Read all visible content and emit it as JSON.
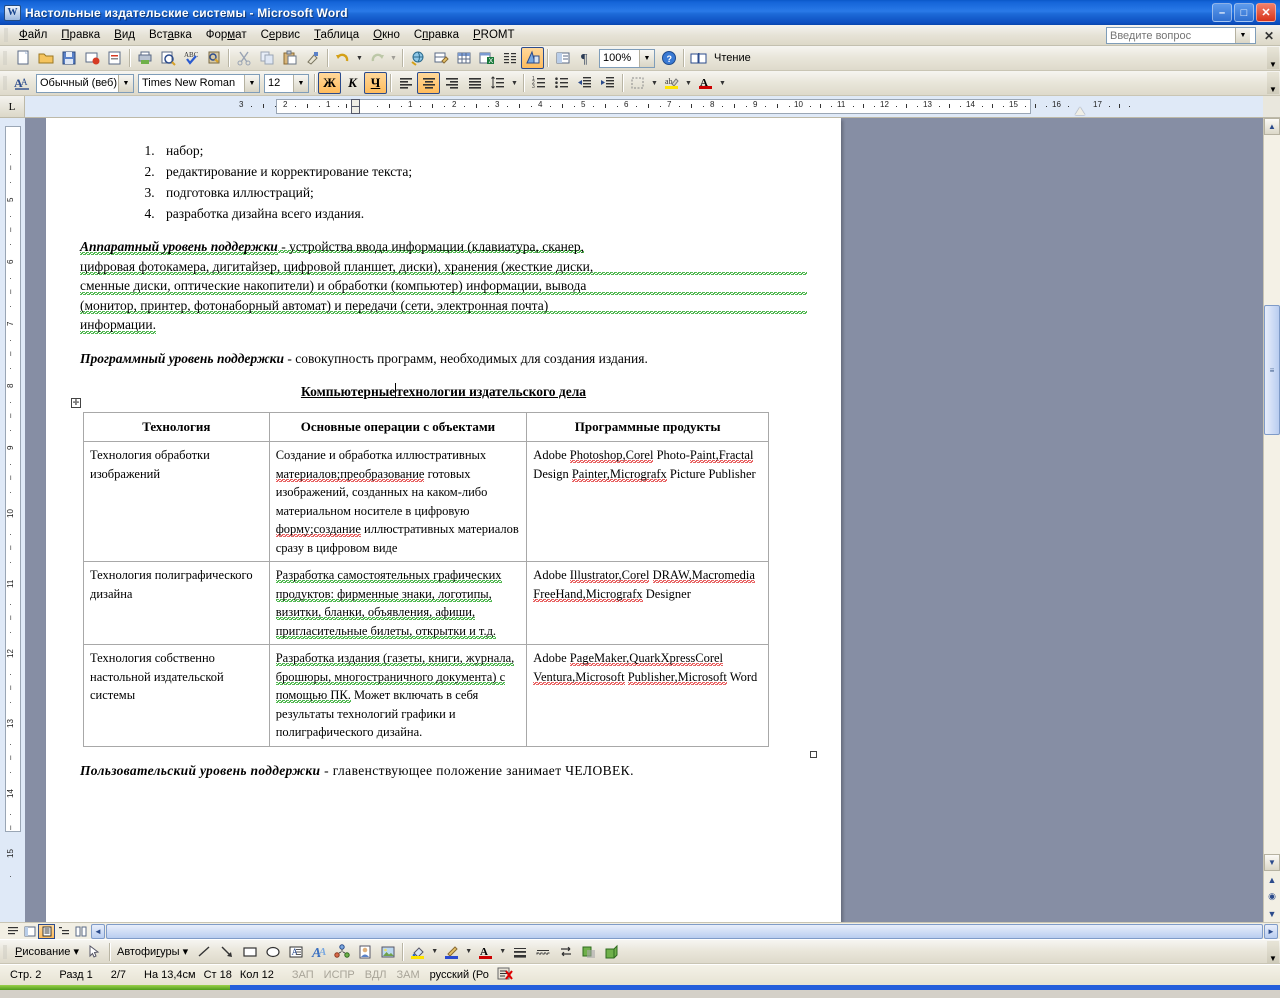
{
  "window": {
    "title": "Настольные издательские системы - Microsoft Word",
    "app_icon": "word-document-icon",
    "minimize": "–",
    "maximize": "□",
    "close": "✕"
  },
  "menu": {
    "items": [
      "Файл",
      "Правка",
      "Вид",
      "Вставка",
      "Формат",
      "Сервис",
      "Таблица",
      "Окно",
      "Справка",
      "PROMT"
    ],
    "ask_placeholder": "Введите вопрос",
    "ask_value": "",
    "close_doc": "✕"
  },
  "standard_toolbar": {
    "zoom_value": "100%",
    "reading_label": "Чтение",
    "buttons": [
      "new-document-icon",
      "open-folder-icon",
      "save-disk-icon",
      "mail-recipient-icon",
      "permission-icon",
      "print-icon",
      "print-preview-icon",
      "spelling-check-icon",
      "research-icon",
      "cut-scissors-icon",
      "copy-icon",
      "paste-clipboard-icon",
      "format-painter-icon",
      "undo-arrow-icon",
      "redo-arrow-icon",
      "insert-hyperlink-icon",
      "tables-and-borders-icon",
      "insert-table-icon",
      "insert-excel-sheet-icon",
      "columns-icon",
      "drawing-icon",
      "document-map-icon",
      "show-formatting-marks-icon",
      "microsoft-word-help-icon",
      "reading-layout-icon"
    ]
  },
  "formatting_toolbar": {
    "style_value": "Обычный (веб)",
    "font_value": "Times New Roman",
    "size_value": "12",
    "bold_label": "Ж",
    "italic_label": "К",
    "underline_label": "Ч",
    "bold_active": true,
    "italic_active": false,
    "underline_active": true,
    "align_center_active": true,
    "buttons": [
      "styles-and-formatting-icon",
      "align-left-icon",
      "align-center-icon",
      "align-right-icon",
      "justify-icon",
      "line-spacing-icon",
      "numbering-icon",
      "bullets-icon",
      "decrease-indent-icon",
      "increase-indent-icon",
      "borders-icon",
      "highlight-color-icon",
      "font-color-icon"
    ]
  },
  "ruler": {
    "corner_label": "L",
    "horizontal_ticks": [
      "3",
      "2",
      "1",
      "1",
      "2",
      "3",
      "4",
      "5",
      "6",
      "7",
      "8",
      "9",
      "10",
      "11",
      "12",
      "13",
      "14",
      "15",
      "16",
      "17"
    ],
    "vertical_ticks": [
      "5",
      "6",
      "7",
      "8",
      "9",
      "10",
      "11",
      "12",
      "13",
      "14"
    ]
  },
  "document": {
    "numbered_list": [
      "набор;",
      "редактирование и корректирование текста;",
      "подготовка иллюстраций;",
      "разработка дизайна всего издания."
    ],
    "para_hardware_term": "Аппаратный уровень поддержки",
    "para_hardware_lines": [
      " - устройства ввода информации (клавиатура, сканер,",
      "цифровая фотокамера, дигитайзер, цифровой планшет, диски), хранения (жесткие диски,",
      "сменные диски, оптические накопители) и обработки (компьютер) информации, вывода",
      "(монитор, принтер, фотонаборный автомат) и передачи (сети, электронная почта)",
      "информации."
    ],
    "para_software_term": "Программный уровень поддержки",
    "para_software_text": " - совокупность программ, необходимых для создания издания.",
    "table_title_part1": "Компьютерные",
    "table_title_part2": "технологии издательского дела",
    "table": {
      "headers": [
        "Технология",
        "Основные операции с объектами",
        "Программные продукты"
      ],
      "rows": [
        {
          "technology": "Технология обработки изображений",
          "operations_segments": [
            {
              "text": "Создание и обработка иллюстративных ",
              "mark": "none"
            },
            {
              "text": "материалов;преобразование",
              "mark": "spell"
            },
            {
              "text": " готовых изображений, созданных на каком-либо материальном носителе в цифровую ",
              "mark": "none"
            },
            {
              "text": "форму;создание",
              "mark": "spell"
            },
            {
              "text": " иллюстративных материалов сразу в цифровом виде",
              "mark": "none"
            }
          ],
          "products_segments": [
            {
              "text": "Adobe ",
              "mark": "none"
            },
            {
              "text": "Photoshop,Corel",
              "mark": "spell"
            },
            {
              "text": " Photo-",
              "mark": "none"
            },
            {
              "text": "Paint,Fractal",
              "mark": "spell"
            },
            {
              "text": " Design ",
              "mark": "none"
            },
            {
              "text": "Painter,Micrografx",
              "mark": "spell"
            },
            {
              "text": " Picture Publisher",
              "mark": "none"
            }
          ]
        },
        {
          "technology": "Технология полиграфического дизайна",
          "operations_segments": [
            {
              "text": "Разработка самостоятельных графических продуктов: фирменные знаки, логотипы, визитки, бланки, объявления, афиши, пригласительные билеты, открытки и т.д.",
              "mark": "grammar"
            }
          ],
          "products_segments": [
            {
              "text": "Adobe ",
              "mark": "none"
            },
            {
              "text": "Illustrator,Corel",
              "mark": "spell"
            },
            {
              "text": " ",
              "mark": "none"
            },
            {
              "text": "DRAW,Macromedia",
              "mark": "spell"
            },
            {
              "text": " ",
              "mark": "none"
            },
            {
              "text": "FreeHand,Micrografx",
              "mark": "spell"
            },
            {
              "text": " Designer",
              "mark": "none"
            }
          ]
        },
        {
          "technology": "Технология собственно настольной издательской системы",
          "operations_segments": [
            {
              "text": "Разработка издания (газеты, книги, журнала, брошюры, многостраничного документа) с помощью ПК.",
              "mark": "grammar"
            },
            {
              "text": " Может включать в себя результаты технологий графики и полиграфического дизайна.",
              "mark": "none"
            }
          ],
          "products_segments": [
            {
              "text": "Adobe ",
              "mark": "none"
            },
            {
              "text": "PageMaker,QuarkXpressCorel",
              "mark": "spell"
            },
            {
              "text": " ",
              "mark": "none"
            },
            {
              "text": "Ventura,Microsoft",
              "mark": "spell"
            },
            {
              "text": " ",
              "mark": "none"
            },
            {
              "text": "Publisher,Microsoft",
              "mark": "spell"
            },
            {
              "text": " Word",
              "mark": "none"
            }
          ]
        }
      ]
    },
    "para_user_term": "Пользовательский уровень поддержки",
    "para_user_text": " -   главенствующее   положение   занимает ЧЕЛОВЕК."
  },
  "drawing_toolbar": {
    "draw_label": "Рисование",
    "autoshapes_label": "Автофигуры",
    "buttons": [
      "select-objects-arrow-icon",
      "line-icon",
      "arrow-icon",
      "rectangle-icon",
      "oval-icon",
      "text-box-icon",
      "wordart-icon",
      "diagram-icon",
      "clip-art-icon",
      "insert-picture-icon",
      "fill-color-icon",
      "line-color-icon",
      "font-color-icon",
      "line-style-icon",
      "dash-style-icon",
      "arrow-style-icon",
      "shadow-style-icon",
      "3d-style-icon"
    ]
  },
  "view_buttons": [
    "normal-view-icon",
    "web-layout-view-icon",
    "print-layout-view-icon",
    "outline-view-icon",
    "reading-layout-view-icon"
  ],
  "status_bar": {
    "page": "Стр. 2",
    "section": "Разд 1",
    "page_of": "2/7",
    "at": "На 13,4см",
    "line": "Ст 18",
    "column": "Кол 12",
    "rec": "ЗАП",
    "trk": "ИСПР",
    "ext": "ВДЛ",
    "ovr": "ЗАМ",
    "language": "русский (Ро",
    "spell_status_icon": "spelling-error-icon"
  },
  "colors": {
    "title_blue": "#1464d8",
    "toolbar_bg": "#e9e6da",
    "doc_gray": "#868ea4",
    "accent_orange": "#ffbc5c",
    "spell_red": "#e03030",
    "grammar_green": "#18a018"
  }
}
